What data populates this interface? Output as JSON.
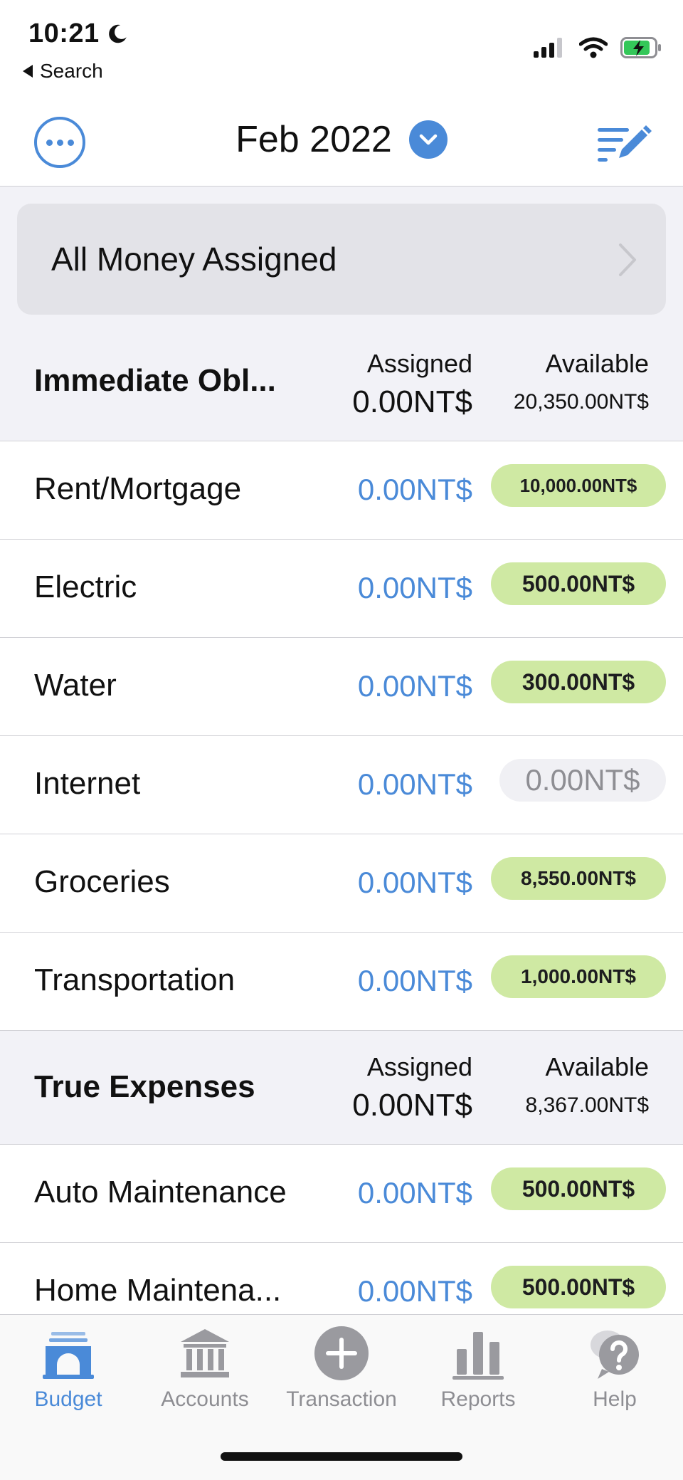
{
  "status_bar": {
    "time": "10:21",
    "back_label": "Search"
  },
  "nav": {
    "month": "Feb 2022"
  },
  "banner": {
    "label": "All Money Assigned"
  },
  "columns": {
    "assigned": "Assigned",
    "available": "Available"
  },
  "groups": [
    {
      "name": "Immediate Obl...",
      "total_assigned": "0.00NT$",
      "total_available": "20,350.00NT$",
      "categories": [
        {
          "name": "Rent/Mortgage",
          "assigned": "0.00NT$",
          "available": "10,000.00NT$",
          "status": "positive"
        },
        {
          "name": "Electric",
          "assigned": "0.00NT$",
          "available": "500.00NT$",
          "status": "positive"
        },
        {
          "name": "Water",
          "assigned": "0.00NT$",
          "available": "300.00NT$",
          "status": "positive"
        },
        {
          "name": "Internet",
          "assigned": "0.00NT$",
          "available": "0.00NT$",
          "status": "zero"
        },
        {
          "name": "Groceries",
          "assigned": "0.00NT$",
          "available": "8,550.00NT$",
          "status": "positive"
        },
        {
          "name": "Transportation",
          "assigned": "0.00NT$",
          "available": "1,000.00NT$",
          "status": "positive"
        }
      ]
    },
    {
      "name": "True Expenses",
      "total_assigned": "0.00NT$",
      "total_available": "8,367.00NT$",
      "categories": [
        {
          "name": "Auto Maintenance",
          "assigned": "0.00NT$",
          "available": "500.00NT$",
          "status": "positive"
        },
        {
          "name": "Home Maintena...",
          "assigned": "0.00NT$",
          "available": "500.00NT$",
          "status": "positive"
        }
      ]
    }
  ],
  "tabs": [
    {
      "label": "Budget",
      "icon": "budget-icon",
      "active": true
    },
    {
      "label": "Accounts",
      "icon": "bank-icon",
      "active": false
    },
    {
      "label": "Transaction",
      "icon": "plus-circle-icon",
      "active": false
    },
    {
      "label": "Reports",
      "icon": "bar-chart-icon",
      "active": false
    },
    {
      "label": "Help",
      "icon": "help-bubble-icon",
      "active": false
    }
  ],
  "colors": {
    "accent": "#4a8ad8",
    "positive_pill": "#cfe9a3",
    "zero_pill": "#f0f0f4",
    "group_background": "#f2f2f7"
  }
}
